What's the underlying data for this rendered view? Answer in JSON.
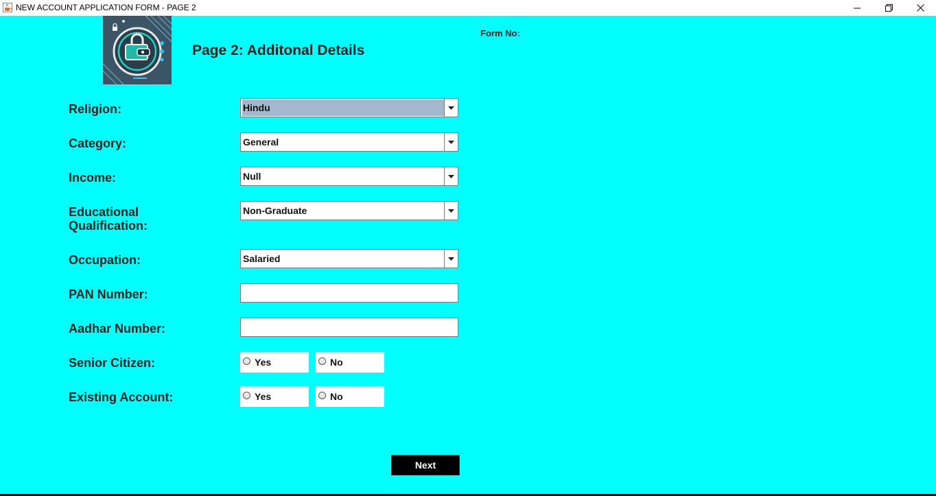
{
  "window": {
    "title": "NEW ACCOUNT APPLICATION FORM - PAGE 2",
    "minimize": "—",
    "maximize": "❐",
    "close": "✕"
  },
  "header": {
    "title": "Page 2: Additonal Details",
    "form_no_label": "Form No:"
  },
  "fields": {
    "religion": {
      "label": "Religion:",
      "value": "Hindu"
    },
    "category": {
      "label": "Category:",
      "value": "General"
    },
    "income": {
      "label": "Income:",
      "value": "Null"
    },
    "education": {
      "label_line1": "Educational",
      "label_line2": "Qualification:",
      "value": "Non-Graduate"
    },
    "occupation": {
      "label": "Occupation:",
      "value": "Salaried"
    },
    "pan": {
      "label": "PAN Number:",
      "value": ""
    },
    "aadhar": {
      "label": "Aadhar Number:",
      "value": ""
    },
    "senior_citizen": {
      "label": "Senior Citizen:",
      "yes": "Yes",
      "no": "No"
    },
    "existing_account": {
      "label": "Existing Account:",
      "yes": "Yes",
      "no": "No"
    }
  },
  "actions": {
    "next": "Next"
  },
  "colors": {
    "background": "#00ffff",
    "selected_item": "#a3b8cc",
    "button": "#000000"
  },
  "icons": {
    "app": "java-cup-icon",
    "logo": "lock-wallet-logo",
    "dropdown": "chevron-down-icon"
  }
}
